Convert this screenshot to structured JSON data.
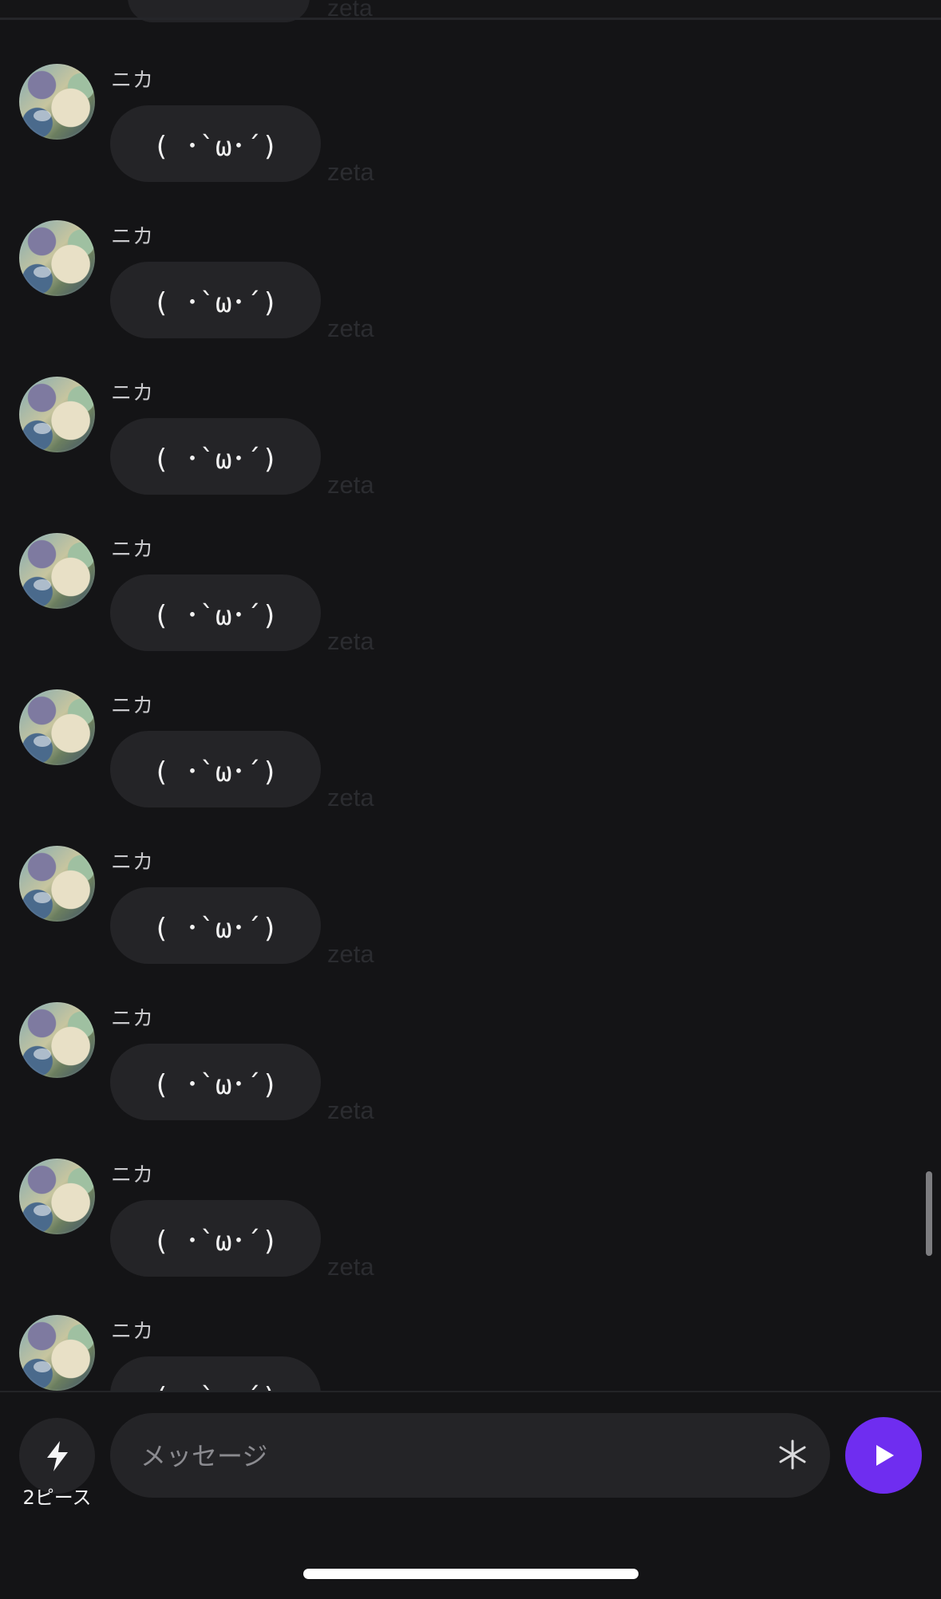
{
  "top_fragment": {
    "zeta": "zeta"
  },
  "messages": [
    {
      "sender": "ニカ",
      "text": "( ･`ω･´)",
      "watermark": "zeta"
    },
    {
      "sender": "ニカ",
      "text": "( ･`ω･´)",
      "watermark": "zeta"
    },
    {
      "sender": "ニカ",
      "text": "( ･`ω･´)",
      "watermark": "zeta"
    },
    {
      "sender": "ニカ",
      "text": "( ･`ω･´)",
      "watermark": "zeta"
    },
    {
      "sender": "ニカ",
      "text": "( ･`ω･´)",
      "watermark": "zeta"
    },
    {
      "sender": "ニカ",
      "text": "( ･`ω･´)",
      "watermark": "zeta"
    },
    {
      "sender": "ニカ",
      "text": "( ･`ω･´)",
      "watermark": "zeta"
    },
    {
      "sender": "ニカ",
      "text": "( ･`ω･´)",
      "watermark": "zeta"
    },
    {
      "sender": "ニカ",
      "text": "( ･`ω･´)",
      "watermark": ""
    }
  ],
  "input_bar": {
    "piece_label": "2ピース",
    "placeholder": "メッセージ",
    "icons": {
      "piece": "lightning-bolt-icon",
      "asterisk": "asterisk-icon",
      "send": "play-icon"
    }
  },
  "colors": {
    "background": "#141416",
    "bubble": "#242427",
    "accent": "#6f2df0"
  }
}
